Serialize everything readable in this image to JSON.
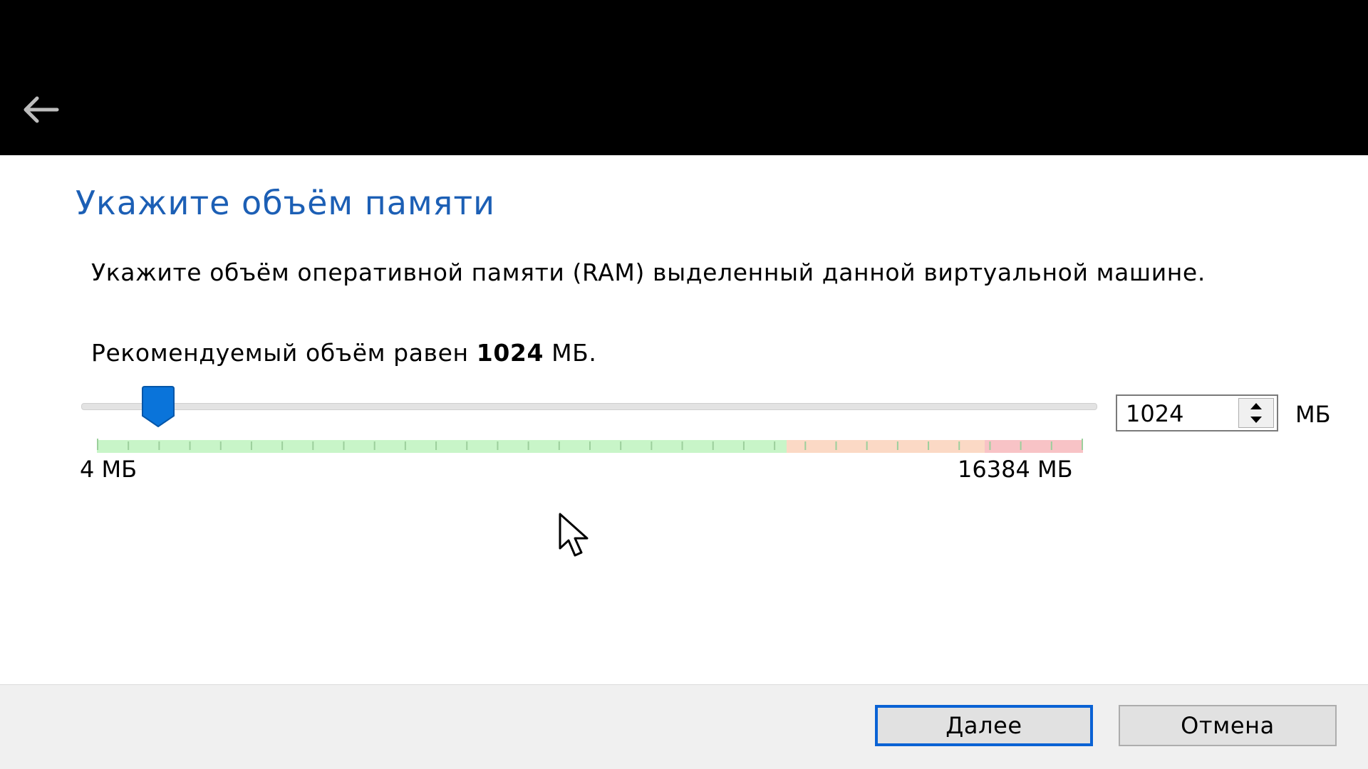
{
  "header": {
    "back_icon": "back-arrow-icon"
  },
  "page": {
    "title": "Укажите объём памяти",
    "description": "Укажите объём оперативной памяти (RAM) выделенный данной виртуальной машине.",
    "recommend_prefix": "Рекомендуемый объём равен ",
    "recommend_value": "1024",
    "recommend_suffix": " МБ."
  },
  "memory": {
    "value": "1024",
    "min": 4,
    "max": 16384,
    "min_label": "4 МБ",
    "max_label": "16384 МБ",
    "unit": "МБ",
    "spin_up_icon": "spin-up-icon",
    "spin_down_icon": "spin-down-icon",
    "zones": {
      "safe_color": "#c8f5c8",
      "warning_color": "#fbd9c5",
      "danger_color": "#f8c3c6",
      "tick_color": "#9ccf9c"
    }
  },
  "theme": {
    "accent": "#1c5fb5",
    "thumb_color": "#0a74da",
    "topbar": "#000000",
    "footer": "#f0f0f0"
  },
  "footer": {
    "next_label": "Далее",
    "cancel_label": "Отмена"
  }
}
